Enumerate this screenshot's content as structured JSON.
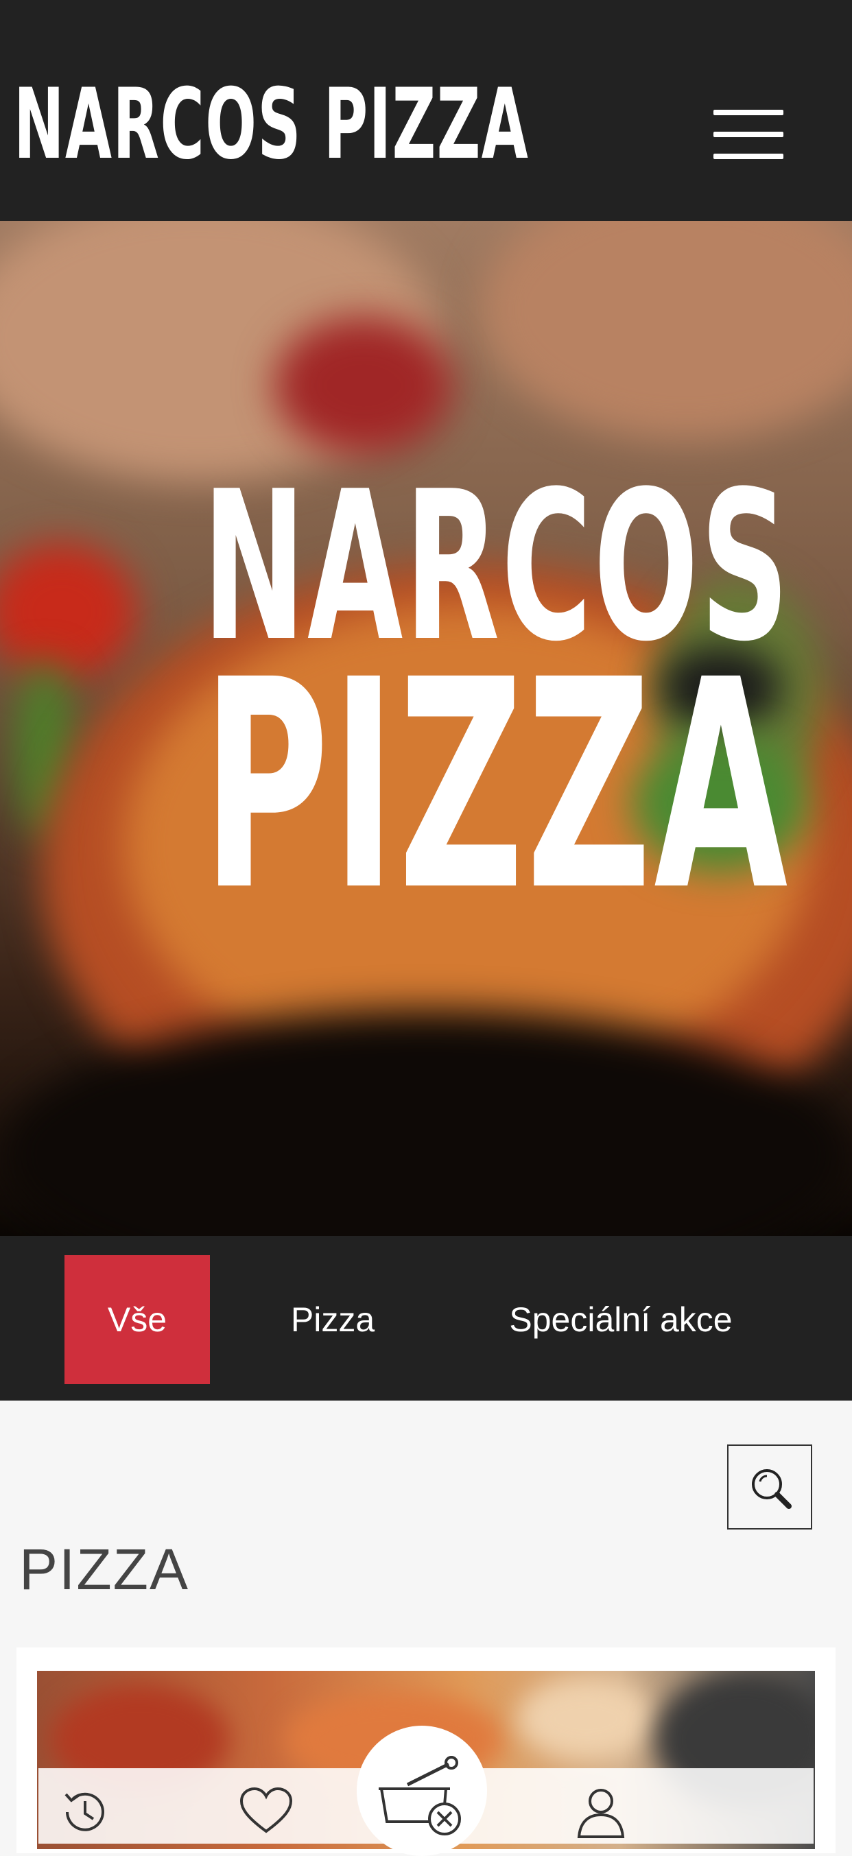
{
  "header": {
    "logo_text": "NARCOS PIZZA",
    "menu_icon": "hamburger-menu-icon"
  },
  "hero": {
    "line1": "NARCOS",
    "line2": "PIZZA"
  },
  "tabs": [
    {
      "label": "Vše",
      "active": true
    },
    {
      "label": "Pizza",
      "active": false
    },
    {
      "label": "Speciální akce",
      "active": false
    }
  ],
  "section": {
    "title": "PIZZA",
    "search_icon": "search-icon"
  },
  "bottom_nav": {
    "items": [
      "history-icon",
      "heart-icon",
      "cart-icon",
      "profile-icon"
    ]
  },
  "colors": {
    "header_bg": "#222222",
    "accent": "#cf2f3c",
    "page_bg": "#f6f6f6"
  }
}
